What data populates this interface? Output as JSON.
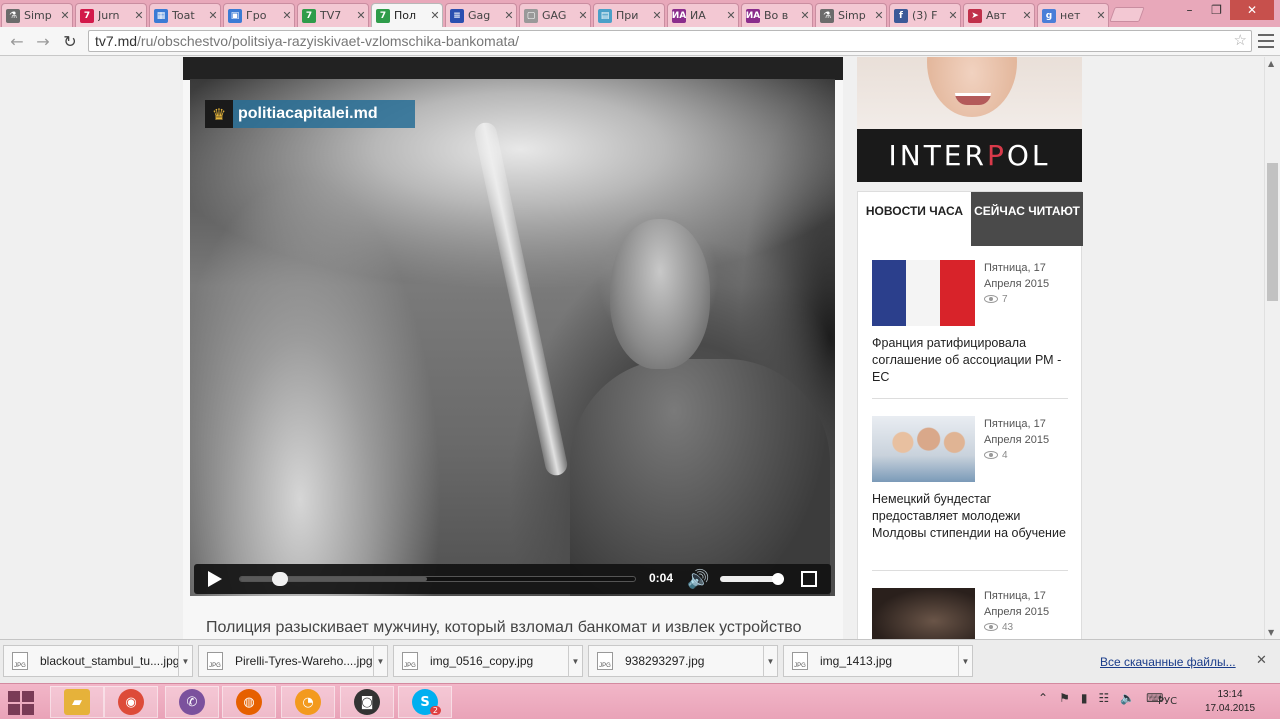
{
  "browser": {
    "tabs": [
      {
        "label": "Simp",
        "icon": "flask-icon",
        "color": "#6b6b6b"
      },
      {
        "label": "Jurn",
        "icon": "jurnal-icon",
        "color": "#d2194a"
      },
      {
        "label": "Toat",
        "icon": "toate-icon",
        "color": "#3a7bd5"
      },
      {
        "label": "Гро",
        "icon": "grom-icon",
        "color": "#3a7bd5"
      },
      {
        "label": "TV7",
        "icon": "tv7-icon",
        "color": "#2e9c4a"
      },
      {
        "label": "Пол",
        "icon": "tv7-icon",
        "color": "#2e9c4a"
      },
      {
        "label": "Gag",
        "icon": "gagauz-icon",
        "color": "#2a4fb0"
      },
      {
        "label": "GAG",
        "icon": "page-icon",
        "color": "#999999"
      },
      {
        "label": "При",
        "icon": "map-icon",
        "color": "#4aa0c8"
      },
      {
        "label": "ИА",
        "icon": "ia-icon",
        "color": "#8a2c8c"
      },
      {
        "label": "Во в",
        "icon": "ia-icon",
        "color": "#8a2c8c"
      },
      {
        "label": "Simp",
        "icon": "flask-icon",
        "color": "#6b6b6b"
      },
      {
        "label": "(3) F",
        "icon": "facebook-icon",
        "color": "#3b5998"
      },
      {
        "label": "Авт",
        "icon": "bird-icon",
        "color": "#c0304a"
      },
      {
        "label": "нет",
        "icon": "google-icon",
        "color": "#4a7ed8"
      }
    ],
    "active_tab_index": 5,
    "url_host": "tv7.md",
    "url_path": "/ru/obschestvo/politsiya-razyiskivaet-vzlomschika-bankomata/",
    "window_min": "–",
    "window_max": "❐",
    "window_close": "✕"
  },
  "video": {
    "watermark": "politiacapitalei.md",
    "time": "0:04",
    "progress_played_fraction": 0.08,
    "progress_buffered_fraction": 0.47,
    "volume_fraction": 0.9
  },
  "article": {
    "lead": "Полиция разыскивает мужчину, который взломал банкомат и извлек устройство"
  },
  "sidebar": {
    "ad_brand_a": "INTER",
    "ad_brand_b": "P",
    "ad_brand_c": "O",
    "ad_brand_d": "L",
    "tab_news": "НОВОСТИ ЧАСА",
    "tab_read": "СЕЙЧАС ЧИТАЮТ",
    "news": [
      {
        "date_line1": "Пятница, 17",
        "date_line2": "Апреля 2015",
        "views": "7",
        "title": "Франция ратифицировала соглашение об ассоциации РМ - ЕС"
      },
      {
        "date_line1": "Пятница, 17",
        "date_line2": "Апреля 2015",
        "views": "4",
        "title": "Немецкий бундестаг предоставляет молодежи Молдовы стипендии на обучение"
      },
      {
        "date_line1": "Пятница, 17",
        "date_line2": "Апреля 2015",
        "views": "43",
        "title": ""
      }
    ]
  },
  "downloads": {
    "items": [
      "blackout_stambul_tu....jpg",
      "Pirelli-Tyres-Wareho....jpg",
      "img_0516_copy.jpg",
      "938293297.jpg",
      "img_1413.jpg"
    ],
    "file_type_label": "JPG",
    "all_downloads": "Все скачанные файлы..."
  },
  "taskbar": {
    "apps": [
      {
        "name": "explorer",
        "icon": "folder-icon",
        "color": "#e6b23a"
      },
      {
        "name": "chrome",
        "icon": "chrome-icon",
        "color": "#dd4b39"
      },
      {
        "name": "viber",
        "icon": "viber-icon",
        "color": "#7b519d"
      },
      {
        "name": "firefox",
        "icon": "firefox-icon",
        "color": "#e66000"
      },
      {
        "name": "ucweb",
        "icon": "squirrel-icon",
        "color": "#f39a1e"
      },
      {
        "name": "camera",
        "icon": "camera-icon",
        "color": "#333333"
      },
      {
        "name": "skype",
        "icon": "skype-icon",
        "color": "#00aff0"
      }
    ],
    "skype_badge": "2",
    "language": "РУС",
    "time": "13:14",
    "date": "17.04.2015"
  }
}
